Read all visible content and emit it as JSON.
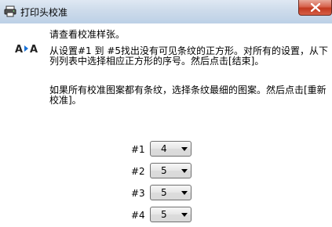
{
  "window": {
    "title": "打印头校准"
  },
  "instructions": {
    "line1": "请查看校准样张。",
    "line2": "从设置#1 到 #5找出没有可见条纹的正方形。对所有的设置，从下列列表中选择相应正方形的序号。然后点击[结束]。",
    "line3": "如果所有校准图案都有条纹，选择条纹最细的图案。然后点击[重新校准]。"
  },
  "settings": [
    {
      "label": "#1",
      "value": "4"
    },
    {
      "label": "#2",
      "value": "5"
    },
    {
      "label": "#3",
      "value": "5"
    },
    {
      "label": "#4",
      "value": "5"
    }
  ]
}
